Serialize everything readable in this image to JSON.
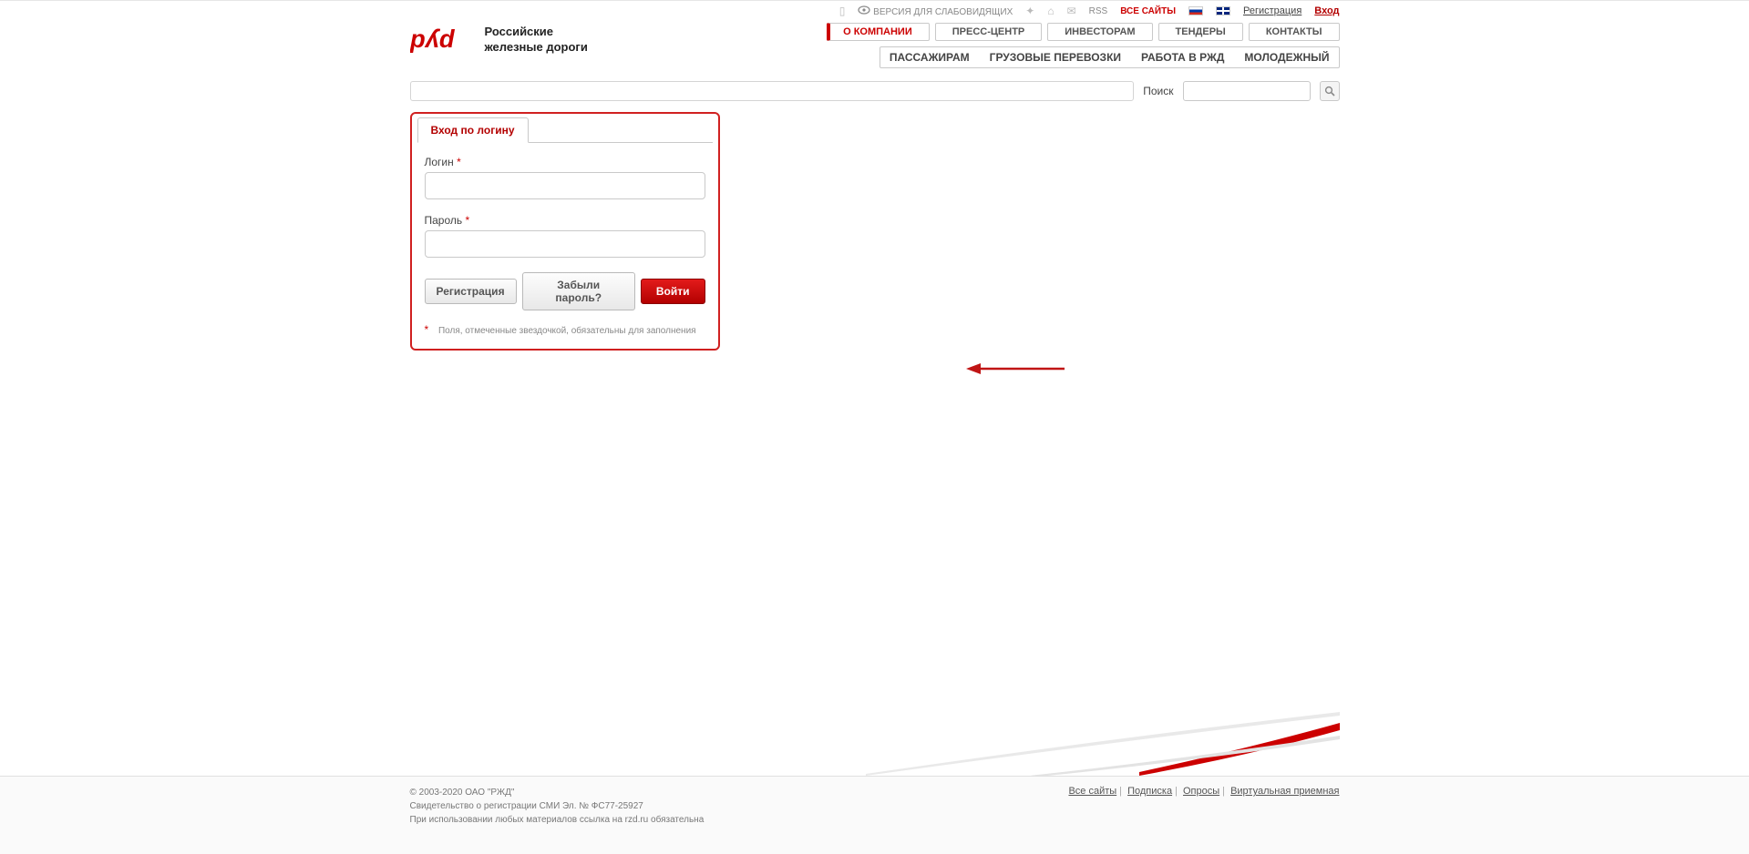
{
  "top_links": {
    "accessibility": "ВЕРСИЯ ДЛЯ СЛАБОВИДЯЩИХ",
    "rss": "RSS",
    "all_sites": "ВСЕ САЙТЫ",
    "registration": "Регистрация",
    "login": "Вход"
  },
  "logo": {
    "line1": "Российские",
    "line2": "железные дороги"
  },
  "nav_primary": [
    "О КОМПАНИИ",
    "ПРЕСС-ЦЕНТР",
    "ИНВЕСТОРАМ",
    "ТЕНДЕРЫ",
    "КОНТАКТЫ"
  ],
  "nav_secondary": [
    "ПАССАЖИРАМ",
    "ГРУЗОВЫЕ ПЕРЕВОЗКИ",
    "РАБОТА В РЖД",
    "МОЛОДЕЖНЫЙ"
  ],
  "search": {
    "label": "Поиск"
  },
  "login_form": {
    "tab": "Вход по логину",
    "login_label": "Логин",
    "password_label": "Пароль",
    "registration_btn": "Регистрация",
    "forgot_btn": "Забыли пароль?",
    "submit_btn": "Войти",
    "footnote": "Поля, отмеченные звездочкой, обязательны для заполнения"
  },
  "footer": {
    "copyright": "© 2003-2020 ОАО \"РЖД\"",
    "reg_cert": "Свидетельство о регистрации СМИ Эл. № ФС77-25927",
    "attribution": "При использовании любых материалов ссылка на rzd.ru обязательна",
    "links": [
      "Все сайты",
      "Подписка",
      "Опросы",
      "Виртуальная приемная"
    ]
  }
}
